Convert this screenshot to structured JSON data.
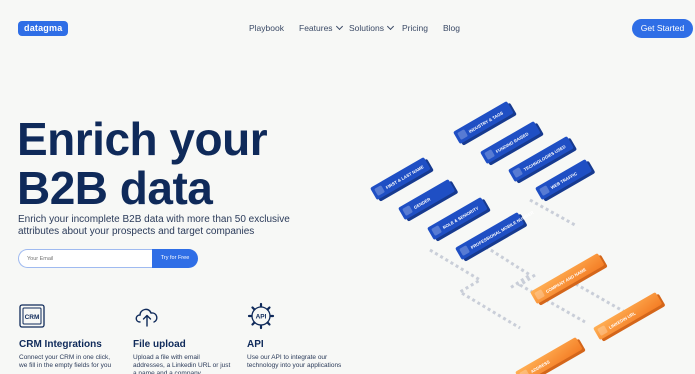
{
  "nav": {
    "logo": "datagma",
    "items": [
      {
        "label": "Playbook",
        "dropdown": false
      },
      {
        "label": "Features",
        "dropdown": true
      },
      {
        "label": "Solutions",
        "dropdown": true
      },
      {
        "label": "Pricing",
        "dropdown": false
      },
      {
        "label": "Blog",
        "dropdown": false
      }
    ],
    "cta": "Get Started"
  },
  "hero": {
    "title_line1": "Enrich your",
    "title_line2": "B2B data",
    "subtitle": "Enrich your incomplete B2B data with more than 50 exclusive attributes about your prospects and target companies",
    "email_placeholder": "Your Email",
    "try_button": "Try for Free"
  },
  "features": [
    {
      "icon": "crm-icon",
      "icon_text": "CRM",
      "title": "CRM Integrations",
      "text": "Connect your CRM in one click, we fill in the empty fields for you"
    },
    {
      "icon": "cloud-upload-icon",
      "title": "File upload",
      "text": "Upload a file with email addresses, a Linkedin URL or just a name and a company"
    },
    {
      "icon": "api-gear-icon",
      "icon_text": "API",
      "title": "API",
      "text": "Use our API to integrate our technology into your applications"
    }
  ],
  "illustration": {
    "blue_cards": [
      "INDUSTRY & TAGS",
      "FUNDING RAISED",
      "TECHNOLOGIES USED",
      "WEB TRAFFIC",
      "FIRST & LAST NAME",
      "GENDER",
      "ROLE & SENIORITY",
      "PROFESSIONAL MOBILE NUMBER"
    ],
    "orange_cards": [
      "COMPANY AND NAME",
      "LINKEDIN URL",
      "ADDRESS"
    ]
  },
  "colors": {
    "primary": "#2f6ee6",
    "navy": "#0f2a5a",
    "card_blue": "#1f4fc4",
    "card_orange": "#f7932f",
    "background": "#f7f8f6"
  }
}
